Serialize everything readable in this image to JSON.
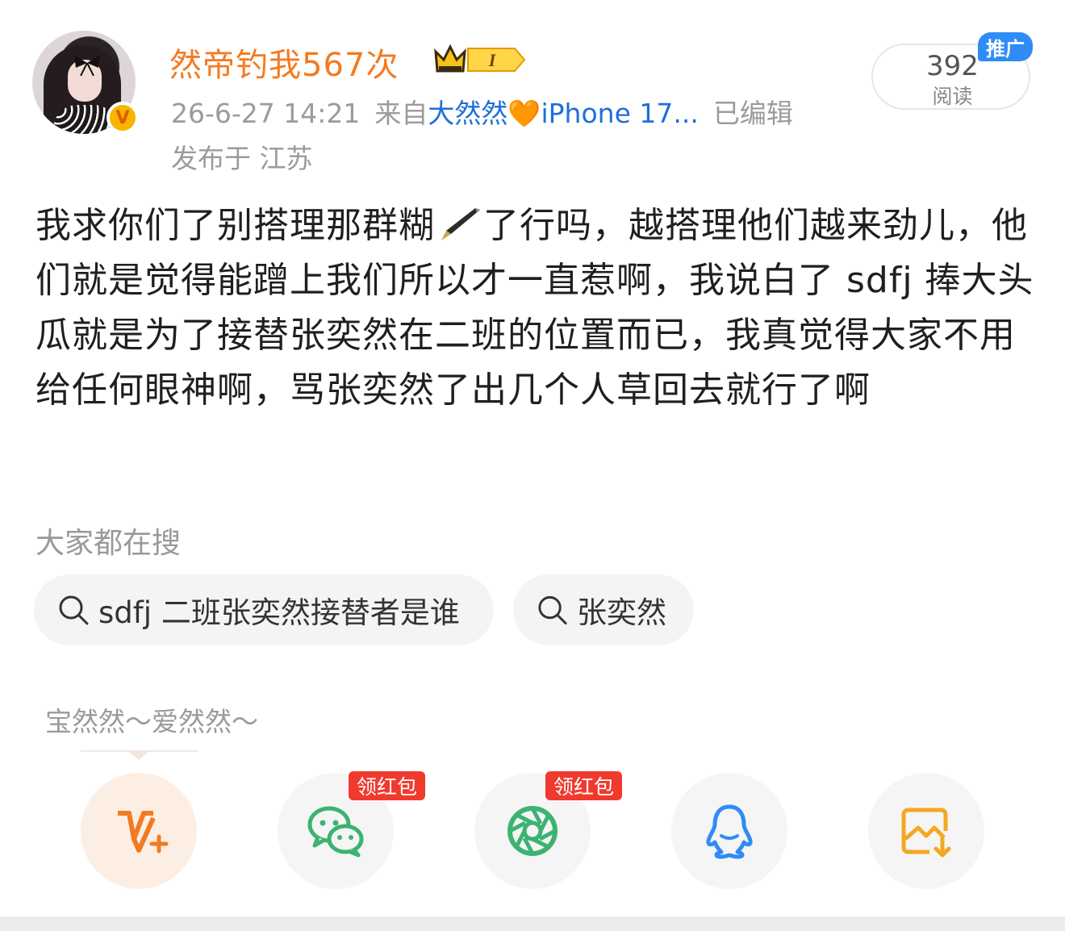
{
  "header": {
    "username": "然帝钓我567次",
    "level_badge_text": "I",
    "time": "26-6-27 14:21",
    "from_prefix": "来自",
    "source": "大然然",
    "heart_glyph": "🧡",
    "device": "iPhone 17...",
    "edited": "已编辑",
    "location": "发布于 江苏",
    "verified_glyph": "V"
  },
  "read_badge": {
    "count": "392",
    "label": "阅读",
    "promo": "推广"
  },
  "post": {
    "text_before_icon": "我求你们了别搭理那群糊",
    "text_after_icon": "了行吗，越搭理他们越来劲儿，他们就是觉得能蹭上我们所以才一直惹啊，我说白了 sdfj 捧大头瓜就是为了接替张奕然在二班的位置而已，我真觉得大家不用给任何眼神啊，骂张奕然了出几个人草回去就行了啊"
  },
  "search": {
    "title": "大家都在搜",
    "chips": [
      "sdfj 二班张奕然接替者是谁",
      "张奕然"
    ]
  },
  "share": {
    "tooltip": "宝然然～爱然然～",
    "red_packet_label": "领红包",
    "icons": [
      "weibo-v-plus-icon",
      "wechat-icon",
      "moments-icon",
      "qq-icon",
      "save-image-icon"
    ]
  },
  "colors": {
    "username": "#f47a1f",
    "source_link": "#1e6fd9",
    "promo": "#2f8cf6",
    "red_packet": "#f03a2e"
  }
}
